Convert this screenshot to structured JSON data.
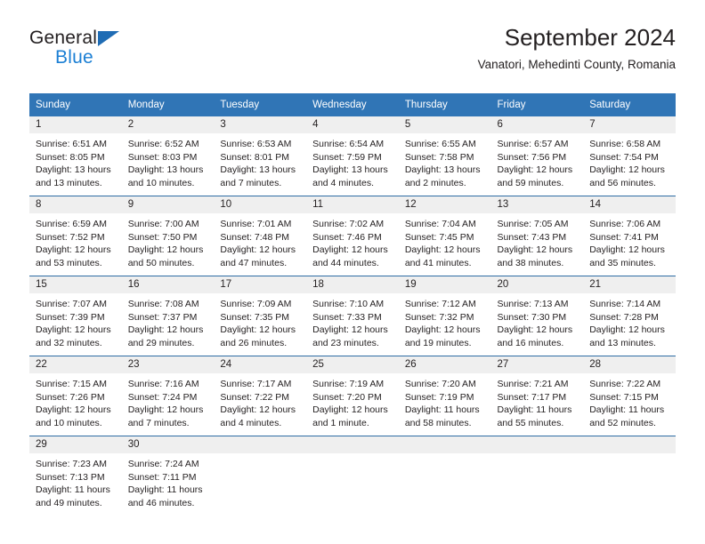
{
  "brand": {
    "name_top": "General",
    "name_bottom": "Blue",
    "accent_color": "#1b7fd4",
    "triangle_color": "#1f6cb4"
  },
  "header": {
    "title": "September 2024",
    "subtitle": "Vanatori, Mehedinti County, Romania"
  },
  "calendar": {
    "header_bg": "#3075b6",
    "header_text_color": "#ffffff",
    "daynum_band_bg": "#efefef",
    "row_border_color": "#2e6da4",
    "weekdays": [
      "Sunday",
      "Monday",
      "Tuesday",
      "Wednesday",
      "Thursday",
      "Friday",
      "Saturday"
    ],
    "weeks": [
      [
        {
          "day": "1",
          "sunrise": "Sunrise: 6:51 AM",
          "sunset": "Sunset: 8:05 PM",
          "daylight1": "Daylight: 13 hours",
          "daylight2": "and 13 minutes."
        },
        {
          "day": "2",
          "sunrise": "Sunrise: 6:52 AM",
          "sunset": "Sunset: 8:03 PM",
          "daylight1": "Daylight: 13 hours",
          "daylight2": "and 10 minutes."
        },
        {
          "day": "3",
          "sunrise": "Sunrise: 6:53 AM",
          "sunset": "Sunset: 8:01 PM",
          "daylight1": "Daylight: 13 hours",
          "daylight2": "and 7 minutes."
        },
        {
          "day": "4",
          "sunrise": "Sunrise: 6:54 AM",
          "sunset": "Sunset: 7:59 PM",
          "daylight1": "Daylight: 13 hours",
          "daylight2": "and 4 minutes."
        },
        {
          "day": "5",
          "sunrise": "Sunrise: 6:55 AM",
          "sunset": "Sunset: 7:58 PM",
          "daylight1": "Daylight: 13 hours",
          "daylight2": "and 2 minutes."
        },
        {
          "day": "6",
          "sunrise": "Sunrise: 6:57 AM",
          "sunset": "Sunset: 7:56 PM",
          "daylight1": "Daylight: 12 hours",
          "daylight2": "and 59 minutes."
        },
        {
          "day": "7",
          "sunrise": "Sunrise: 6:58 AM",
          "sunset": "Sunset: 7:54 PM",
          "daylight1": "Daylight: 12 hours",
          "daylight2": "and 56 minutes."
        }
      ],
      [
        {
          "day": "8",
          "sunrise": "Sunrise: 6:59 AM",
          "sunset": "Sunset: 7:52 PM",
          "daylight1": "Daylight: 12 hours",
          "daylight2": "and 53 minutes."
        },
        {
          "day": "9",
          "sunrise": "Sunrise: 7:00 AM",
          "sunset": "Sunset: 7:50 PM",
          "daylight1": "Daylight: 12 hours",
          "daylight2": "and 50 minutes."
        },
        {
          "day": "10",
          "sunrise": "Sunrise: 7:01 AM",
          "sunset": "Sunset: 7:48 PM",
          "daylight1": "Daylight: 12 hours",
          "daylight2": "and 47 minutes."
        },
        {
          "day": "11",
          "sunrise": "Sunrise: 7:02 AM",
          "sunset": "Sunset: 7:46 PM",
          "daylight1": "Daylight: 12 hours",
          "daylight2": "and 44 minutes."
        },
        {
          "day": "12",
          "sunrise": "Sunrise: 7:04 AM",
          "sunset": "Sunset: 7:45 PM",
          "daylight1": "Daylight: 12 hours",
          "daylight2": "and 41 minutes."
        },
        {
          "day": "13",
          "sunrise": "Sunrise: 7:05 AM",
          "sunset": "Sunset: 7:43 PM",
          "daylight1": "Daylight: 12 hours",
          "daylight2": "and 38 minutes."
        },
        {
          "day": "14",
          "sunrise": "Sunrise: 7:06 AM",
          "sunset": "Sunset: 7:41 PM",
          "daylight1": "Daylight: 12 hours",
          "daylight2": "and 35 minutes."
        }
      ],
      [
        {
          "day": "15",
          "sunrise": "Sunrise: 7:07 AM",
          "sunset": "Sunset: 7:39 PM",
          "daylight1": "Daylight: 12 hours",
          "daylight2": "and 32 minutes."
        },
        {
          "day": "16",
          "sunrise": "Sunrise: 7:08 AM",
          "sunset": "Sunset: 7:37 PM",
          "daylight1": "Daylight: 12 hours",
          "daylight2": "and 29 minutes."
        },
        {
          "day": "17",
          "sunrise": "Sunrise: 7:09 AM",
          "sunset": "Sunset: 7:35 PM",
          "daylight1": "Daylight: 12 hours",
          "daylight2": "and 26 minutes."
        },
        {
          "day": "18",
          "sunrise": "Sunrise: 7:10 AM",
          "sunset": "Sunset: 7:33 PM",
          "daylight1": "Daylight: 12 hours",
          "daylight2": "and 23 minutes."
        },
        {
          "day": "19",
          "sunrise": "Sunrise: 7:12 AM",
          "sunset": "Sunset: 7:32 PM",
          "daylight1": "Daylight: 12 hours",
          "daylight2": "and 19 minutes."
        },
        {
          "day": "20",
          "sunrise": "Sunrise: 7:13 AM",
          "sunset": "Sunset: 7:30 PM",
          "daylight1": "Daylight: 12 hours",
          "daylight2": "and 16 minutes."
        },
        {
          "day": "21",
          "sunrise": "Sunrise: 7:14 AM",
          "sunset": "Sunset: 7:28 PM",
          "daylight1": "Daylight: 12 hours",
          "daylight2": "and 13 minutes."
        }
      ],
      [
        {
          "day": "22",
          "sunrise": "Sunrise: 7:15 AM",
          "sunset": "Sunset: 7:26 PM",
          "daylight1": "Daylight: 12 hours",
          "daylight2": "and 10 minutes."
        },
        {
          "day": "23",
          "sunrise": "Sunrise: 7:16 AM",
          "sunset": "Sunset: 7:24 PM",
          "daylight1": "Daylight: 12 hours",
          "daylight2": "and 7 minutes."
        },
        {
          "day": "24",
          "sunrise": "Sunrise: 7:17 AM",
          "sunset": "Sunset: 7:22 PM",
          "daylight1": "Daylight: 12 hours",
          "daylight2": "and 4 minutes."
        },
        {
          "day": "25",
          "sunrise": "Sunrise: 7:19 AM",
          "sunset": "Sunset: 7:20 PM",
          "daylight1": "Daylight: 12 hours",
          "daylight2": "and 1 minute."
        },
        {
          "day": "26",
          "sunrise": "Sunrise: 7:20 AM",
          "sunset": "Sunset: 7:19 PM",
          "daylight1": "Daylight: 11 hours",
          "daylight2": "and 58 minutes."
        },
        {
          "day": "27",
          "sunrise": "Sunrise: 7:21 AM",
          "sunset": "Sunset: 7:17 PM",
          "daylight1": "Daylight: 11 hours",
          "daylight2": "and 55 minutes."
        },
        {
          "day": "28",
          "sunrise": "Sunrise: 7:22 AM",
          "sunset": "Sunset: 7:15 PM",
          "daylight1": "Daylight: 11 hours",
          "daylight2": "and 52 minutes."
        }
      ],
      [
        {
          "day": "29",
          "sunrise": "Sunrise: 7:23 AM",
          "sunset": "Sunset: 7:13 PM",
          "daylight1": "Daylight: 11 hours",
          "daylight2": "and 49 minutes."
        },
        {
          "day": "30",
          "sunrise": "Sunrise: 7:24 AM",
          "sunset": "Sunset: 7:11 PM",
          "daylight1": "Daylight: 11 hours",
          "daylight2": "and 46 minutes."
        },
        {
          "day": "",
          "sunrise": "",
          "sunset": "",
          "daylight1": "",
          "daylight2": ""
        },
        {
          "day": "",
          "sunrise": "",
          "sunset": "",
          "daylight1": "",
          "daylight2": ""
        },
        {
          "day": "",
          "sunrise": "",
          "sunset": "",
          "daylight1": "",
          "daylight2": ""
        },
        {
          "day": "",
          "sunrise": "",
          "sunset": "",
          "daylight1": "",
          "daylight2": ""
        },
        {
          "day": "",
          "sunrise": "",
          "sunset": "",
          "daylight1": "",
          "daylight2": ""
        }
      ]
    ]
  }
}
